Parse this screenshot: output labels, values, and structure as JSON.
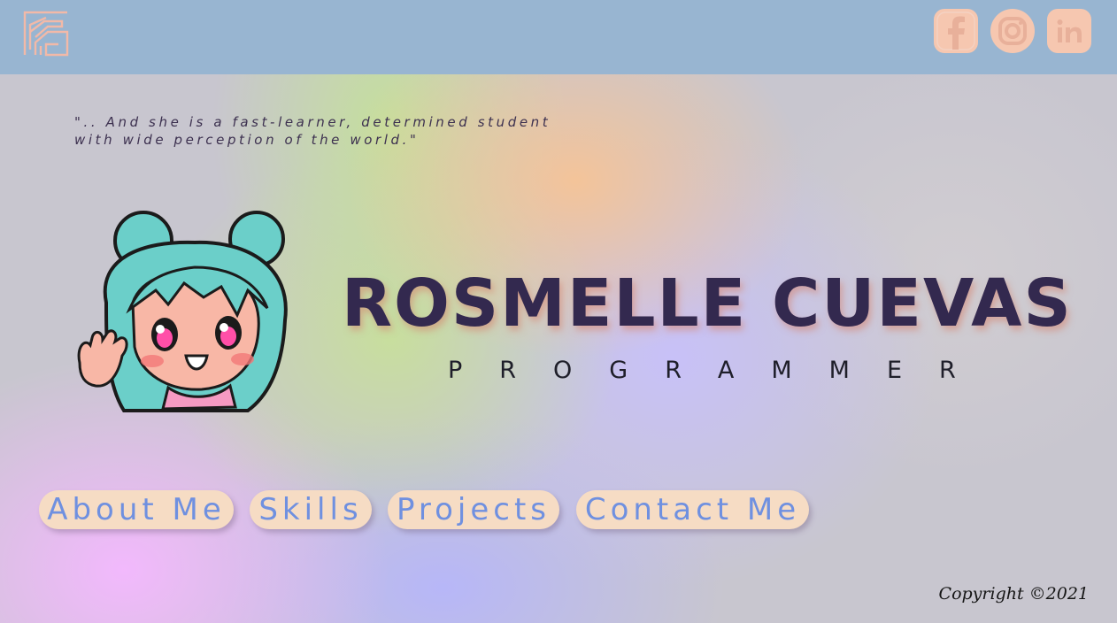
{
  "header": {
    "logo_icon": "rg-monogram-logo",
    "social_links": [
      {
        "icon": "facebook-icon",
        "label": "Facebook"
      },
      {
        "icon": "instagram-icon",
        "label": "Instagram"
      },
      {
        "icon": "linkedin-icon",
        "label": "LinkedIn"
      }
    ],
    "colors": {
      "bar": "#98b5d1",
      "icon_bg": "#f6c7b0"
    }
  },
  "hero": {
    "quote": "\".. And she is a fast-learner, determined student with wide perception of the world.\"",
    "avatar_icon": "anime-girl-avatar-waving",
    "name": "ROSMELLE CUEVAS",
    "role": "PROGRAMMER"
  },
  "nav": {
    "about": "About Me",
    "skills": "Skills",
    "projects": "Projects",
    "contact": "Contact Me"
  },
  "footer": {
    "copyright": "Copyright ©2021"
  },
  "colors": {
    "name_text": "#33294f",
    "button_bg": "#f6dcc4",
    "button_text": "#6f90e0"
  }
}
